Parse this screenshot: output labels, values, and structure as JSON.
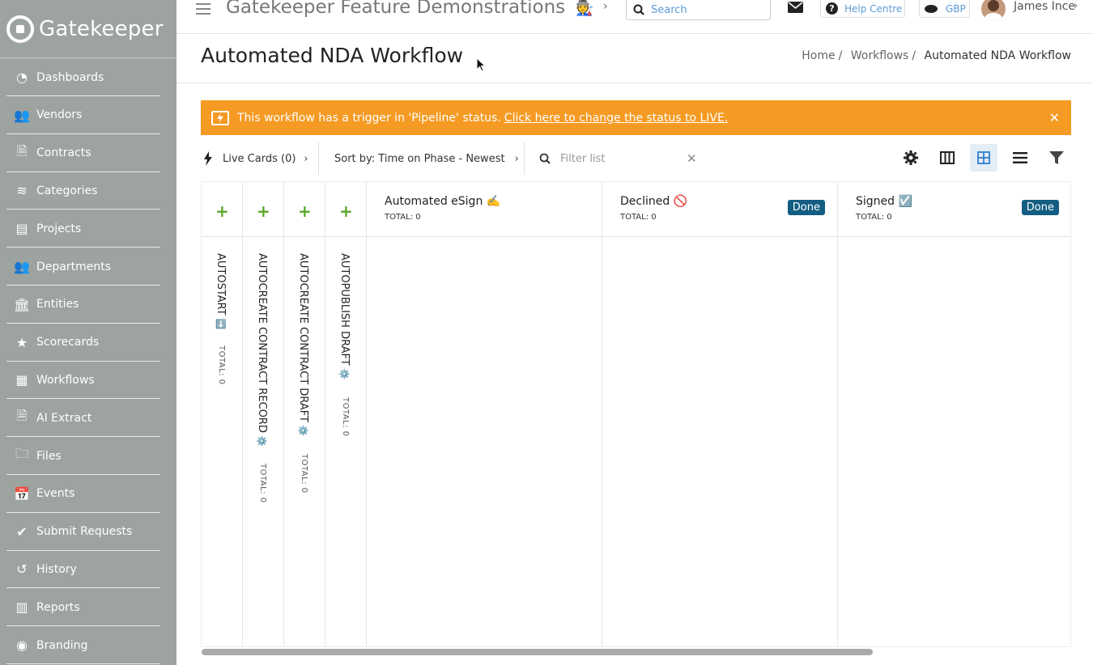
{
  "sidebar": {
    "logo_text": "Gatekeeper",
    "items": [
      {
        "label": "Dashboards",
        "icon": "dashboard-icon"
      },
      {
        "label": "Vendors",
        "icon": "vendors-icon"
      },
      {
        "label": "Contracts",
        "icon": "contracts-icon"
      },
      {
        "label": "Categories",
        "icon": "categories-icon"
      },
      {
        "label": "Projects",
        "icon": "projects-icon"
      },
      {
        "label": "Departments",
        "icon": "departments-icon"
      },
      {
        "label": "Entities",
        "icon": "entities-icon"
      },
      {
        "label": "Scorecards",
        "icon": "scorecards-icon"
      },
      {
        "label": "Workflows",
        "icon": "workflows-icon"
      },
      {
        "label": "AI Extract",
        "icon": "ai-extract-icon"
      },
      {
        "label": "Files",
        "icon": "files-icon"
      },
      {
        "label": "Events",
        "icon": "events-icon"
      },
      {
        "label": "Submit Requests",
        "icon": "submit-requests-icon"
      },
      {
        "label": "History",
        "icon": "history-icon"
      },
      {
        "label": "Reports",
        "icon": "reports-icon"
      },
      {
        "label": "Branding",
        "icon": "branding-icon"
      }
    ]
  },
  "topbar": {
    "title": "Gatekeeper Feature Demonstrations",
    "title_emoji": "🧑‍🏭",
    "search_placeholder": "Search",
    "help_label": "Help Centre",
    "currency": "GBP",
    "user_name": "James Ince"
  },
  "page": {
    "title": "Automated NDA Workflow",
    "breadcrumb": [
      "Home",
      "Workflows",
      "Automated NDA Workflow"
    ]
  },
  "alert": {
    "text": "This workflow has a trigger in 'Pipeline' status.",
    "link": "Click here to change the status to LIVE.",
    "color": "#f59a23"
  },
  "toolbar": {
    "live_cards": "Live Cards (0)",
    "sort": "Sort by: Time on Phase - Newest",
    "filter_placeholder": "Filter list"
  },
  "board": {
    "narrow_columns": [
      {
        "title": "AUTOSTART",
        "emoji": "➡️",
        "total": "TOTAL: 0"
      },
      {
        "title": "AUTOCREATE CONTRACT RECORD",
        "emoji": "⚙️",
        "total": "TOTAL: 0"
      },
      {
        "title": "AUTOCREATE CONTRACT DRAFT",
        "emoji": "⚙️",
        "total": "TOTAL: 0"
      },
      {
        "title": "AUTOPUBLISH DRAFT",
        "emoji": "⚙️",
        "total": "TOTAL: 0"
      }
    ],
    "wide_columns": [
      {
        "title": "Automated eSign ✍️",
        "total": "TOTAL: 0",
        "badge": ""
      },
      {
        "title": "Declined 🚫",
        "total": "TOTAL: 0",
        "badge": "Done"
      },
      {
        "title": "Signed ☑️",
        "total": "TOTAL: 0",
        "badge": "Done"
      }
    ],
    "add_symbol": "+"
  },
  "colors": {
    "sidebar_bg": "#9da39f",
    "accent": "#135e82",
    "add_green": "#5aa82b",
    "link_blue": "#5b9bd5"
  }
}
